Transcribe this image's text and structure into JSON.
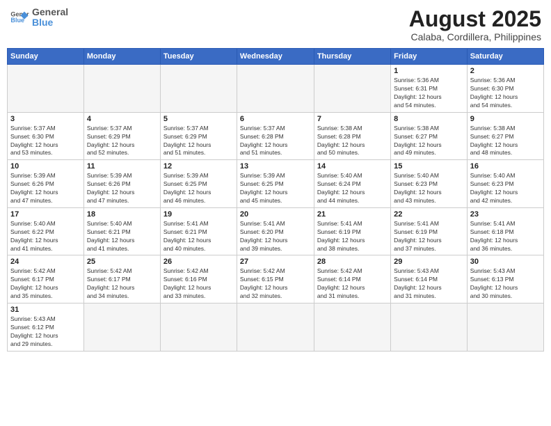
{
  "header": {
    "logo_general": "General",
    "logo_blue": "Blue",
    "month_title": "August 2025",
    "location": "Calaba, Cordillera, Philippines"
  },
  "days_of_week": [
    "Sunday",
    "Monday",
    "Tuesday",
    "Wednesday",
    "Thursday",
    "Friday",
    "Saturday"
  ],
  "weeks": [
    [
      {
        "day": "",
        "info": ""
      },
      {
        "day": "",
        "info": ""
      },
      {
        "day": "",
        "info": ""
      },
      {
        "day": "",
        "info": ""
      },
      {
        "day": "",
        "info": ""
      },
      {
        "day": "1",
        "info": "Sunrise: 5:36 AM\nSunset: 6:31 PM\nDaylight: 12 hours\nand 54 minutes."
      },
      {
        "day": "2",
        "info": "Sunrise: 5:36 AM\nSunset: 6:30 PM\nDaylight: 12 hours\nand 54 minutes."
      }
    ],
    [
      {
        "day": "3",
        "info": "Sunrise: 5:37 AM\nSunset: 6:30 PM\nDaylight: 12 hours\nand 53 minutes."
      },
      {
        "day": "4",
        "info": "Sunrise: 5:37 AM\nSunset: 6:29 PM\nDaylight: 12 hours\nand 52 minutes."
      },
      {
        "day": "5",
        "info": "Sunrise: 5:37 AM\nSunset: 6:29 PM\nDaylight: 12 hours\nand 51 minutes."
      },
      {
        "day": "6",
        "info": "Sunrise: 5:37 AM\nSunset: 6:28 PM\nDaylight: 12 hours\nand 51 minutes."
      },
      {
        "day": "7",
        "info": "Sunrise: 5:38 AM\nSunset: 6:28 PM\nDaylight: 12 hours\nand 50 minutes."
      },
      {
        "day": "8",
        "info": "Sunrise: 5:38 AM\nSunset: 6:27 PM\nDaylight: 12 hours\nand 49 minutes."
      },
      {
        "day": "9",
        "info": "Sunrise: 5:38 AM\nSunset: 6:27 PM\nDaylight: 12 hours\nand 48 minutes."
      }
    ],
    [
      {
        "day": "10",
        "info": "Sunrise: 5:39 AM\nSunset: 6:26 PM\nDaylight: 12 hours\nand 47 minutes."
      },
      {
        "day": "11",
        "info": "Sunrise: 5:39 AM\nSunset: 6:26 PM\nDaylight: 12 hours\nand 47 minutes."
      },
      {
        "day": "12",
        "info": "Sunrise: 5:39 AM\nSunset: 6:25 PM\nDaylight: 12 hours\nand 46 minutes."
      },
      {
        "day": "13",
        "info": "Sunrise: 5:39 AM\nSunset: 6:25 PM\nDaylight: 12 hours\nand 45 minutes."
      },
      {
        "day": "14",
        "info": "Sunrise: 5:40 AM\nSunset: 6:24 PM\nDaylight: 12 hours\nand 44 minutes."
      },
      {
        "day": "15",
        "info": "Sunrise: 5:40 AM\nSunset: 6:23 PM\nDaylight: 12 hours\nand 43 minutes."
      },
      {
        "day": "16",
        "info": "Sunrise: 5:40 AM\nSunset: 6:23 PM\nDaylight: 12 hours\nand 42 minutes."
      }
    ],
    [
      {
        "day": "17",
        "info": "Sunrise: 5:40 AM\nSunset: 6:22 PM\nDaylight: 12 hours\nand 41 minutes."
      },
      {
        "day": "18",
        "info": "Sunrise: 5:40 AM\nSunset: 6:21 PM\nDaylight: 12 hours\nand 41 minutes."
      },
      {
        "day": "19",
        "info": "Sunrise: 5:41 AM\nSunset: 6:21 PM\nDaylight: 12 hours\nand 40 minutes."
      },
      {
        "day": "20",
        "info": "Sunrise: 5:41 AM\nSunset: 6:20 PM\nDaylight: 12 hours\nand 39 minutes."
      },
      {
        "day": "21",
        "info": "Sunrise: 5:41 AM\nSunset: 6:19 PM\nDaylight: 12 hours\nand 38 minutes."
      },
      {
        "day": "22",
        "info": "Sunrise: 5:41 AM\nSunset: 6:19 PM\nDaylight: 12 hours\nand 37 minutes."
      },
      {
        "day": "23",
        "info": "Sunrise: 5:41 AM\nSunset: 6:18 PM\nDaylight: 12 hours\nand 36 minutes."
      }
    ],
    [
      {
        "day": "24",
        "info": "Sunrise: 5:42 AM\nSunset: 6:17 PM\nDaylight: 12 hours\nand 35 minutes."
      },
      {
        "day": "25",
        "info": "Sunrise: 5:42 AM\nSunset: 6:17 PM\nDaylight: 12 hours\nand 34 minutes."
      },
      {
        "day": "26",
        "info": "Sunrise: 5:42 AM\nSunset: 6:16 PM\nDaylight: 12 hours\nand 33 minutes."
      },
      {
        "day": "27",
        "info": "Sunrise: 5:42 AM\nSunset: 6:15 PM\nDaylight: 12 hours\nand 32 minutes."
      },
      {
        "day": "28",
        "info": "Sunrise: 5:42 AM\nSunset: 6:14 PM\nDaylight: 12 hours\nand 31 minutes."
      },
      {
        "day": "29",
        "info": "Sunrise: 5:43 AM\nSunset: 6:14 PM\nDaylight: 12 hours\nand 31 minutes."
      },
      {
        "day": "30",
        "info": "Sunrise: 5:43 AM\nSunset: 6:13 PM\nDaylight: 12 hours\nand 30 minutes."
      }
    ],
    [
      {
        "day": "31",
        "info": "Sunrise: 5:43 AM\nSunset: 6:12 PM\nDaylight: 12 hours\nand 29 minutes."
      },
      {
        "day": "",
        "info": ""
      },
      {
        "day": "",
        "info": ""
      },
      {
        "day": "",
        "info": ""
      },
      {
        "day": "",
        "info": ""
      },
      {
        "day": "",
        "info": ""
      },
      {
        "day": "",
        "info": ""
      }
    ]
  ]
}
